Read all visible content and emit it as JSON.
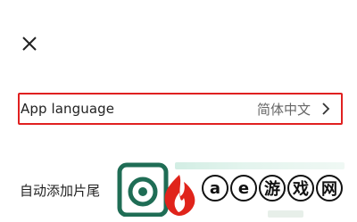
{
  "screen": {
    "close_icon": "close-icon"
  },
  "language_row": {
    "label": "App language",
    "value": "简体中文",
    "chevron_icon": "chevron-right-icon"
  },
  "auto_row": {
    "label": "自动添加片尾"
  },
  "watermark": {
    "chars": [
      "a",
      "e",
      "游",
      "戏",
      "网"
    ],
    "logo": "flame-logo"
  },
  "colors": {
    "highlight_border": "#e02020",
    "flame_red": "#e0241b",
    "camera_green": "#1f6d55"
  }
}
